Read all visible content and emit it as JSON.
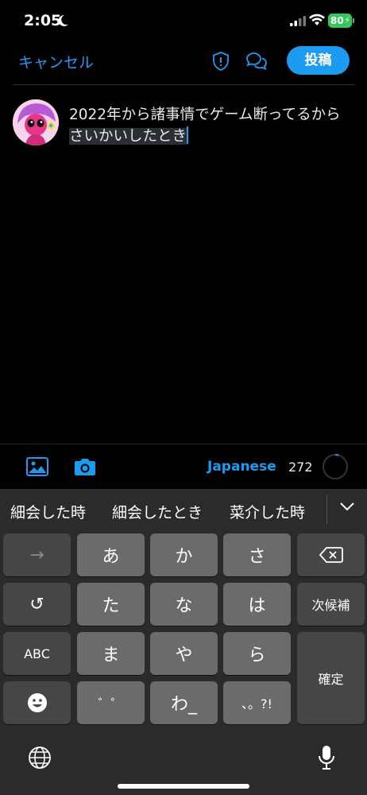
{
  "status": {
    "time": "2:05",
    "battery": "80"
  },
  "header": {
    "cancel": "キャンセル",
    "post": "投稿"
  },
  "compose": {
    "line1": "2022年から諸事情でゲーム断ってるから",
    "marked": "さいかいしたとき"
  },
  "toolbar": {
    "language": "Japanese",
    "remaining": "272",
    "progress": 0.05
  },
  "keyboard": {
    "suggestions": [
      "細会した時",
      "細会したとき",
      "菜介した時"
    ],
    "keys": {
      "arrow": "→",
      "a": "あ",
      "ka": "か",
      "sa": "さ",
      "undo": "↺",
      "ta": "た",
      "na": "な",
      "ha": "は",
      "next": "次候補",
      "abc": "ABC",
      "ma": "ま",
      "ya": "や",
      "ra": "ら",
      "confirm": "確定",
      "dakuten": "゛゜",
      "wa": "わ_",
      "punct": "、。?!"
    }
  },
  "colors": {
    "accent": "#1d9bf0",
    "battery": "#34c759",
    "background": "#000000",
    "keyboard": "#2b2b2b"
  }
}
